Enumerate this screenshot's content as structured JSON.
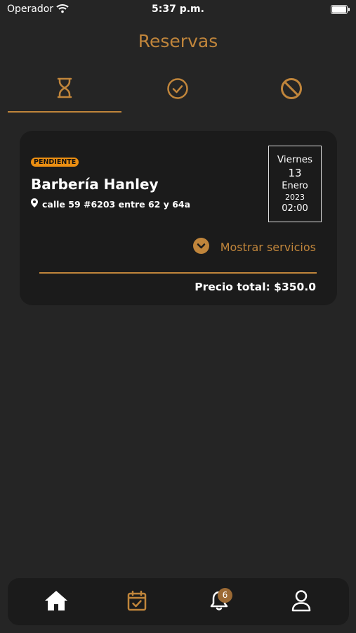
{
  "status": {
    "carrier": "Operador",
    "time": "5:37 p.m."
  },
  "title": "Reservas",
  "tabs": [
    {
      "icon": "hourglass-icon",
      "active": true
    },
    {
      "icon": "check-circle-icon",
      "active": false
    },
    {
      "icon": "ban-icon",
      "active": false
    }
  ],
  "reservation": {
    "status": "PENDIENTE",
    "shop_name": "Barbería Hanley",
    "address": "calle 59 #6203 entre 62 y 64a",
    "date": {
      "weekday": "Viernes",
      "day": "13",
      "month": "Enero",
      "year": "2023",
      "time": "02:00"
    },
    "show_services_label": "Mostrar servicios",
    "total_label": "Precio total: $350.0"
  },
  "nav": {
    "items": [
      {
        "icon": "home-icon",
        "active": true
      },
      {
        "icon": "calendar-check-icon",
        "active": false
      },
      {
        "icon": "bell-icon",
        "active": false,
        "badge": "6"
      },
      {
        "icon": "user-icon",
        "active": false
      }
    ]
  },
  "colors": {
    "accent": "#c0853b",
    "background": "#252525",
    "card": "#1b1b1b",
    "badge": "#ec8f12"
  }
}
